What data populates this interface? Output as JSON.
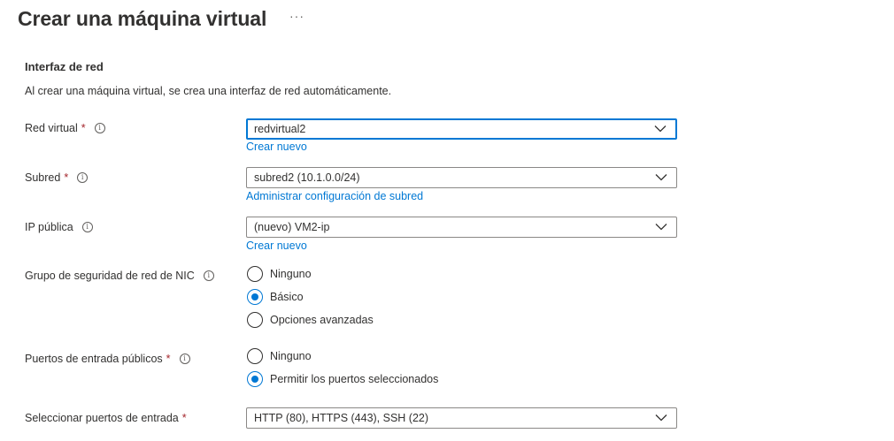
{
  "header": {
    "title": "Crear una máquina virtual",
    "more_label": "···"
  },
  "section": {
    "title": "Interfaz de red",
    "description": "Al crear una máquina virtual, se crea una interfaz de red automáticamente."
  },
  "fields": {
    "red_virtual": {
      "label": "Red virtual",
      "required_mark": "*",
      "info_icon": "i",
      "value": "redvirtual2",
      "link": "Crear nuevo"
    },
    "subred": {
      "label": "Subred",
      "required_mark": "*",
      "info_icon": "i",
      "value": "subred2 (10.1.0.0/24)",
      "link": "Administrar configuración de subred"
    },
    "ip_publica": {
      "label": "IP pública",
      "info_icon": "i",
      "value": "(nuevo) VM2-ip",
      "link": "Crear nuevo"
    },
    "nsg": {
      "label": "Grupo de seguridad de red de NIC",
      "info_icon": "i",
      "options": [
        "Ninguno",
        "Básico",
        "Opciones avanzadas"
      ],
      "selected": "Básico"
    },
    "puertos_publicos": {
      "label": "Puertos de entrada públicos",
      "required_mark": "*",
      "info_icon": "i",
      "options": [
        "Ninguno",
        "Permitir los puertos seleccionados"
      ],
      "selected": "Permitir los puertos seleccionados"
    },
    "puertos_entrada": {
      "label": "Seleccionar puertos de entrada",
      "required_mark": "*",
      "value": "HTTP (80), HTTPS (443), SSH (22)"
    }
  },
  "colors": {
    "accent": "#0078d4",
    "required": "#a4262c",
    "text": "#323130",
    "border": "#8a8886"
  }
}
